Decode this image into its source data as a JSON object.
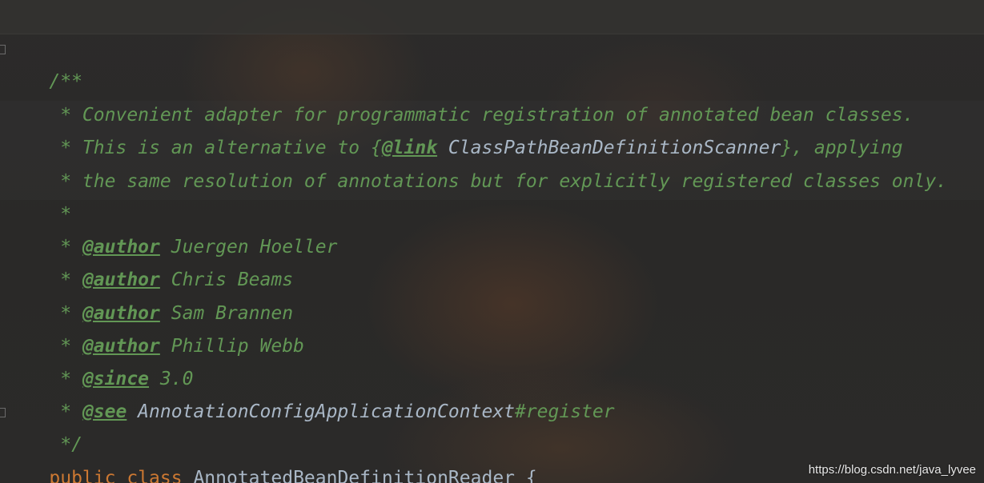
{
  "code": {
    "line1": "/**",
    "line2": " * Convenient adapter for programmatic registration of annotated bean classes.",
    "line3_prefix": " * This is an alternative to {",
    "line3_tag": "@link",
    "line3_ref": " ClassPathBeanDefinitionScanner",
    "line3_suffix": "}, applying",
    "line4": " * the same resolution of annotations but for explicitly registered classes only.",
    "line5": " *",
    "author_prefix": " * ",
    "author_tag": "@author",
    "author1": " Juergen Hoeller",
    "author2": " Chris Beams",
    "author3": " Sam Brannen",
    "author4": " Phillip Webb",
    "since_tag": "@since",
    "since_value": " 3.0",
    "see_tag": "@see",
    "see_ref": " AnnotationConfigApplicationContext",
    "see_suffix": "#register",
    "close": " */",
    "decl_kw1": "public",
    "decl_kw2": "class",
    "decl_name": " AnnotatedBeanDefinitionReader {"
  },
  "watermark": "https://blog.csdn.net/java_lyvee",
  "colors": {
    "doc_comment": "#629755",
    "keyword": "#cc7832",
    "identifier": "#a9b7c6",
    "background": "#2b2b2b"
  }
}
